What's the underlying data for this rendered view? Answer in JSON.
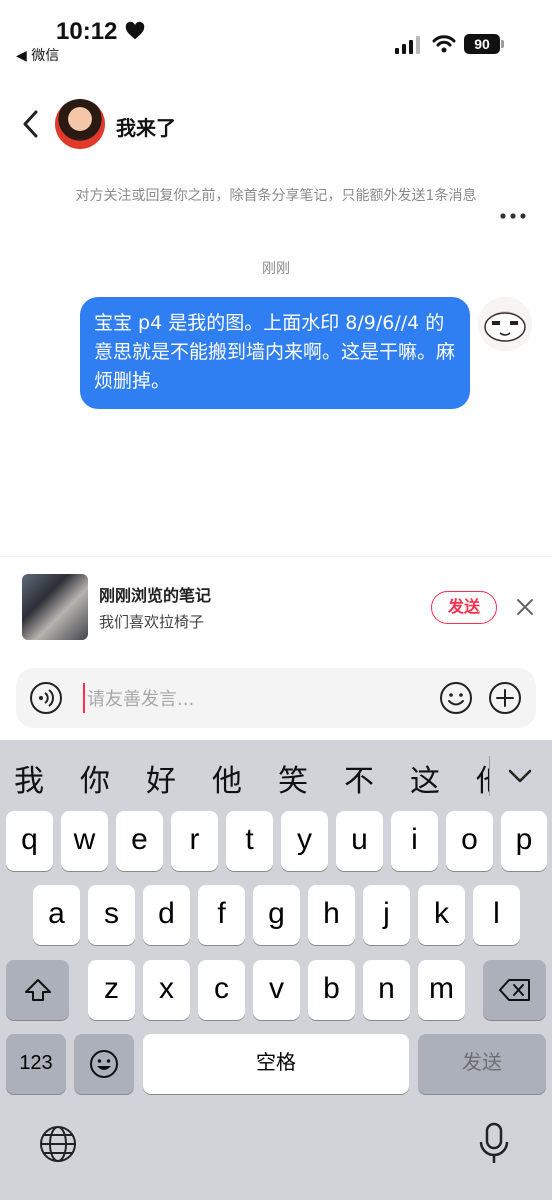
{
  "status_bar": {
    "time": "10:12",
    "back_app": "◀ 微信",
    "battery": "90"
  },
  "header": {
    "title": "我来了"
  },
  "chat": {
    "notice": "对方关注或回复你之前，除首条分享笔记，只能额外发送1条消息",
    "timestamp": "刚刚",
    "messages": [
      {
        "text": "宝宝 p4 是我的图。上面水印 8/9/6//4 的意思就是不能搬到墙内来啊。这是干嘛。麻烦删掉。"
      }
    ]
  },
  "recent_note": {
    "title": "刚刚浏览的笔记",
    "subtitle": "我们喜欢拉椅子",
    "send_label": "发送"
  },
  "input": {
    "placeholder": "请友善发言..."
  },
  "keyboard": {
    "candidates": [
      "我",
      "你",
      "好",
      "他",
      "笑",
      "不",
      "这",
      "他"
    ],
    "row1": [
      "q",
      "w",
      "e",
      "r",
      "t",
      "y",
      "u",
      "i",
      "o",
      "p"
    ],
    "row2": [
      "a",
      "s",
      "d",
      "f",
      "g",
      "h",
      "j",
      "k",
      "l"
    ],
    "row3": [
      "z",
      "x",
      "c",
      "v",
      "b",
      "n",
      "m"
    ],
    "num_label": "123",
    "space_label": "空格",
    "send_label": "发送"
  },
  "colors": {
    "bubble": "#2f7ef2",
    "accent": "#ff2e4d",
    "keyboard_bg": "#d1d3d9"
  },
  "icons": [
    "heart-icon",
    "signal-icon",
    "wifi-icon",
    "back-chevron-icon",
    "more-dots-icon",
    "close-icon",
    "voice-icon",
    "emoji-icon",
    "plus-icon",
    "chevron-down-icon",
    "shift-icon",
    "backspace-icon",
    "globe-icon",
    "mic-icon"
  ]
}
